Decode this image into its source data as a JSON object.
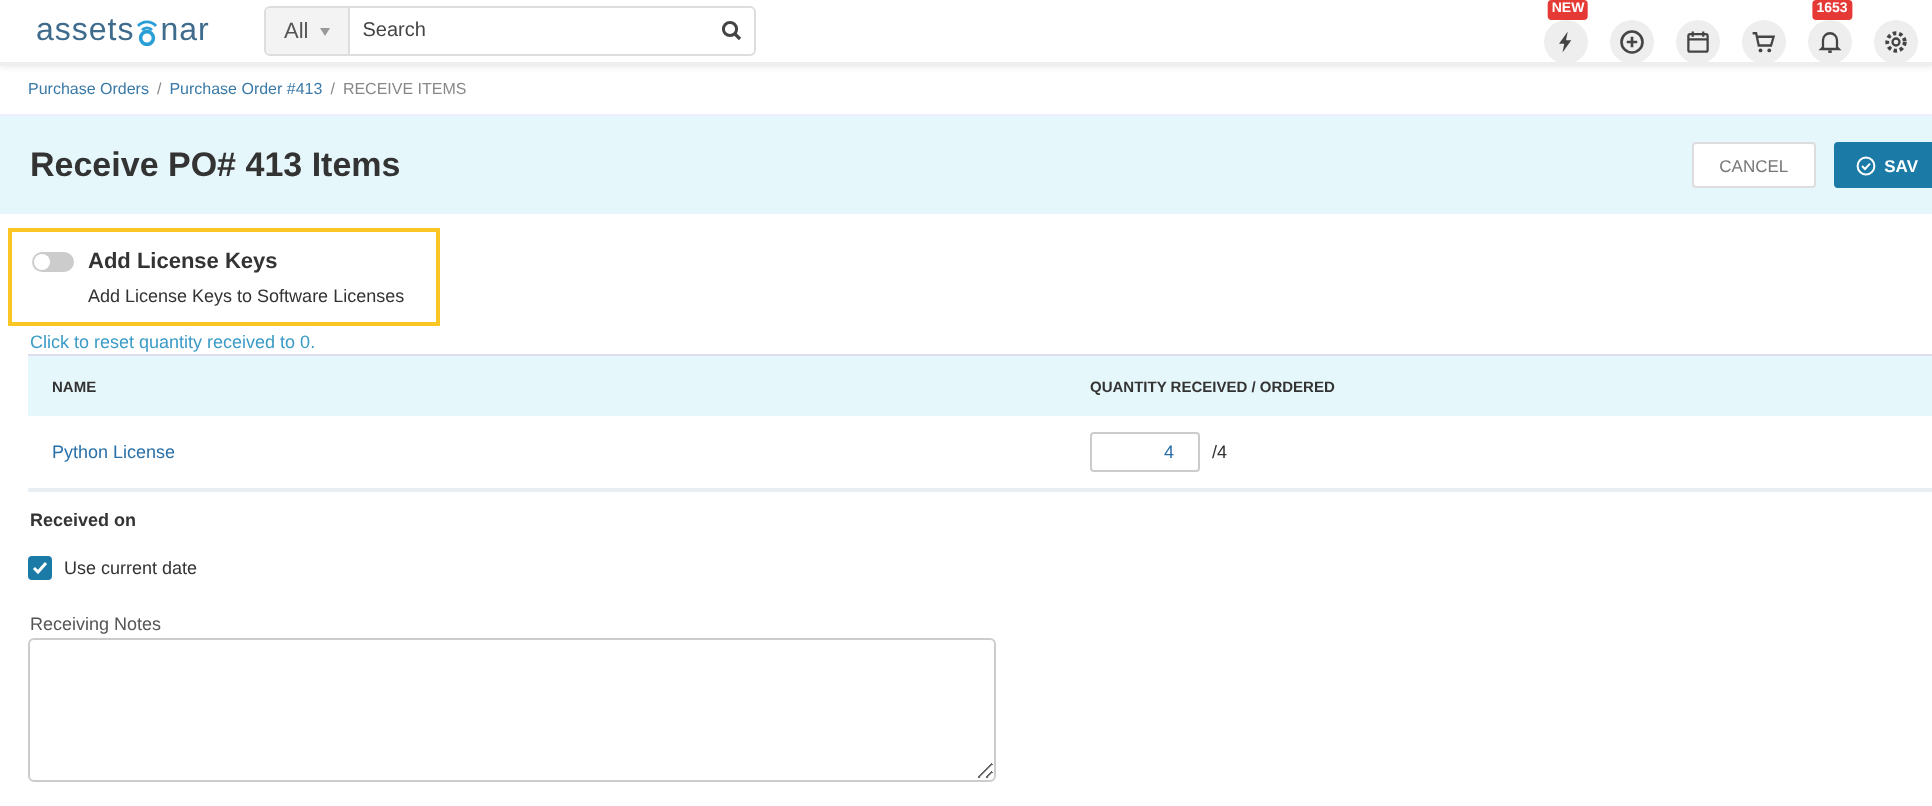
{
  "header": {
    "logo": {
      "before": "assets",
      "after": "nar"
    },
    "search": {
      "scope": "All",
      "placeholder": "Search"
    },
    "icons": [
      {
        "kind": "bolt",
        "badge": "NEW"
      },
      {
        "kind": "plus"
      },
      {
        "kind": "calendar"
      },
      {
        "kind": "cart"
      },
      {
        "kind": "bell",
        "badge": "1653"
      },
      {
        "kind": "gear"
      }
    ]
  },
  "breadcrumb": [
    {
      "label": "Purchase Orders",
      "link": true,
      "separator": "/"
    },
    {
      "label": "Purchase Order #413",
      "link": true,
      "separator": "/"
    },
    {
      "label": "RECEIVE ITEMS",
      "link": false
    }
  ],
  "title": "Receive PO# 413 Items",
  "buttons": [
    {
      "label": "CANCEL",
      "kind": "secondary"
    },
    {
      "label": "SAV",
      "kind": "primary"
    }
  ],
  "license_keys": {
    "title": "Add License Keys",
    "description": "Add License Keys to Software Licenses",
    "on": false,
    "highlighted": true
  },
  "reset_link": "Click to reset quantity received to 0.",
  "table": {
    "columns": [
      "NAME",
      "QUANTITY RECEIVED / ORDERED"
    ],
    "rows": [
      {
        "name": "Python License",
        "received": "4",
        "ordered": "/4"
      }
    ]
  },
  "received_on": {
    "label": "Received on",
    "checkbox": {
      "label": "Use current date",
      "checked": true
    }
  },
  "notes": {
    "label": "Receiving Notes"
  }
}
